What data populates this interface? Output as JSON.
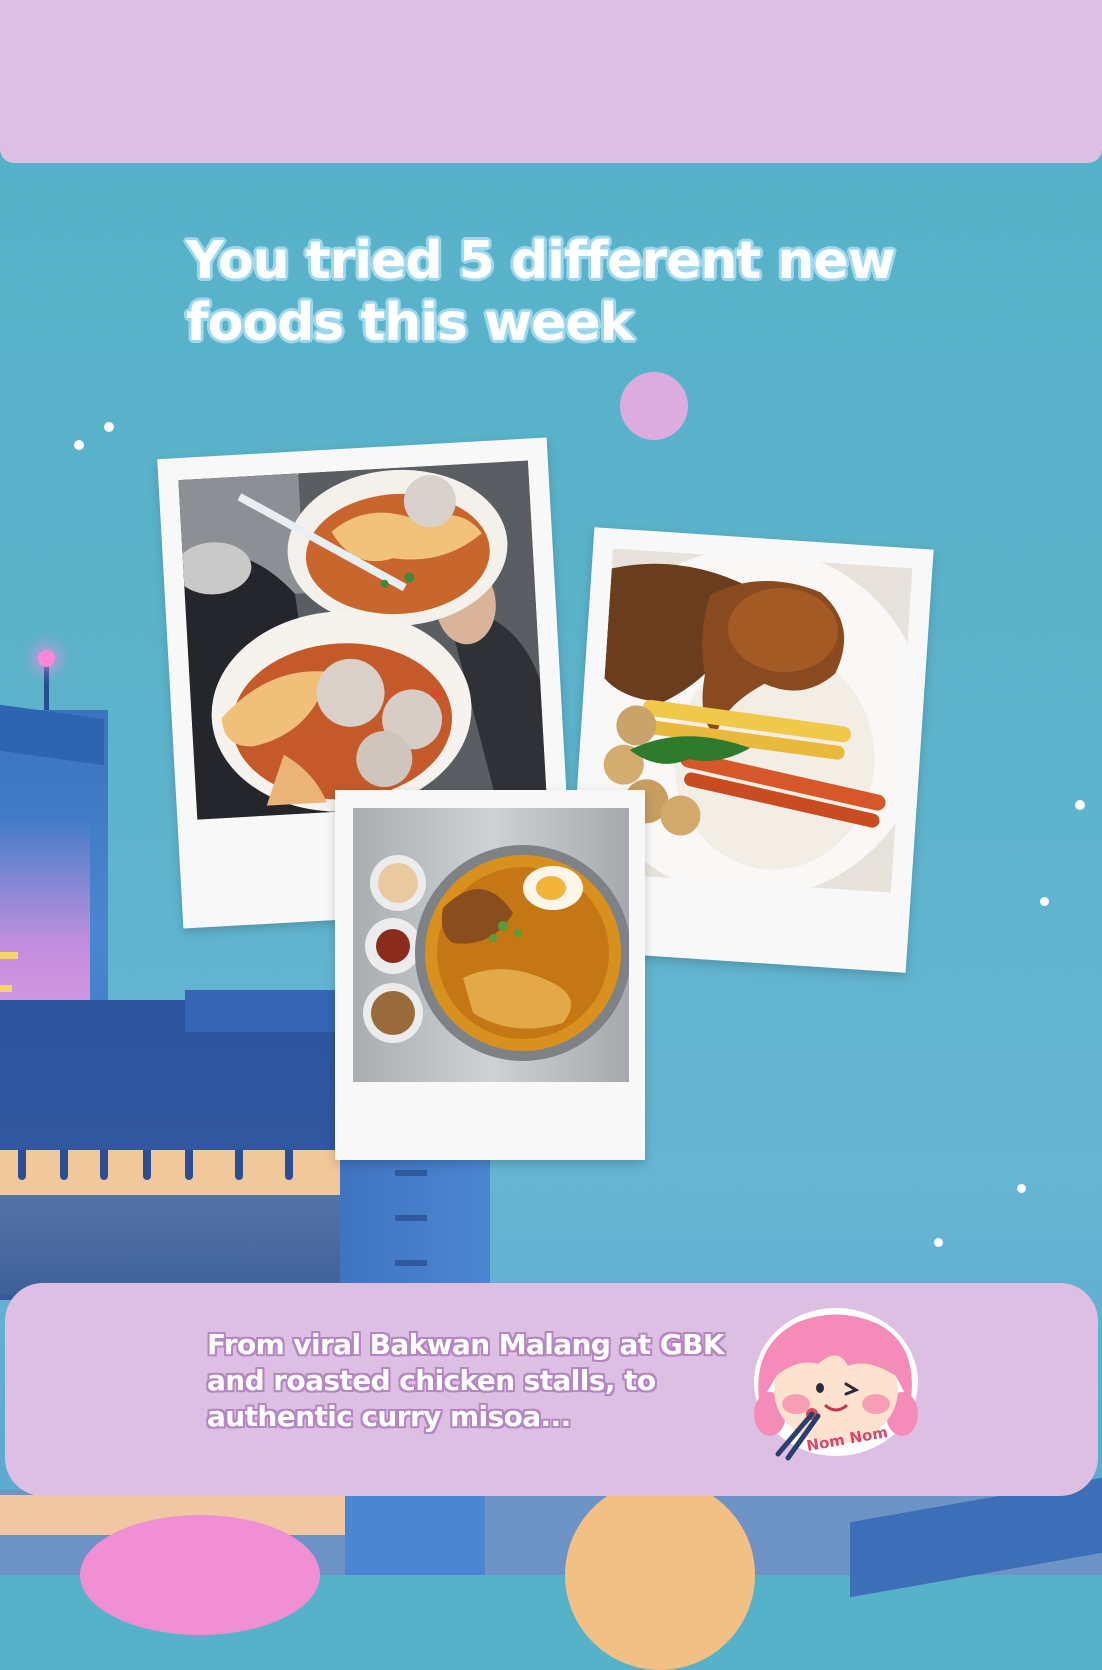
{
  "headline": {
    "line1": "You tried 5 different new",
    "line2": "foods this week"
  },
  "caption": {
    "line1": "From viral Bakwan Malang at GBK",
    "line2": "and roasted chicken stalls, to",
    "line3": "authentic curry misoa..."
  },
  "sticker": {
    "label": "Nom Nom"
  },
  "colors": {
    "background": "#5cb3cb",
    "panel": "#ddbfe3",
    "accent_dot": "#ddacdf",
    "headline_outline": "#9fd8ee",
    "caption_outline": "#b685c4"
  }
}
